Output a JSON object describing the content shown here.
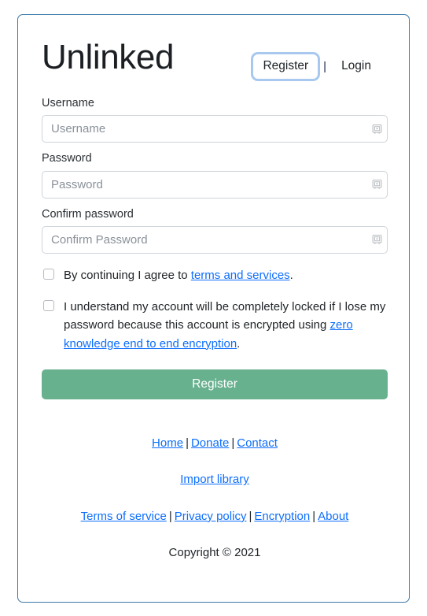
{
  "brand": {
    "title": "Unlinked"
  },
  "auth_nav": {
    "register_label": "Register",
    "separator": "|",
    "login_label": "Login",
    "focused_item": "Register",
    "focus_ring_color": "#a8c8f0"
  },
  "form": {
    "fields": [
      {
        "label": "Username",
        "placeholder": "Username",
        "value": "",
        "type": "text",
        "icon": "password-manager-icon"
      },
      {
        "label": "Password",
        "placeholder": "Password",
        "value": "",
        "type": "password",
        "icon": "password-manager-icon"
      },
      {
        "label": "Confirm password",
        "placeholder": "Confirm Password",
        "value": "",
        "type": "password",
        "icon": "password-manager-icon"
      }
    ],
    "checkboxes": [
      {
        "checked": false,
        "text_before": "By continuing I agree to ",
        "link_text": "terms and services",
        "text_after": "."
      },
      {
        "checked": false,
        "text_before": "I understand my account will be completely locked if I lose my password because this account is encrypted using ",
        "link_text": "zero knowledge end to end encryption",
        "text_after": "."
      }
    ],
    "submit_label": "Register",
    "submit_color": "#68b18f"
  },
  "footer": {
    "row1": [
      {
        "label": "Home"
      },
      {
        "label": "Donate"
      },
      {
        "label": "Contact"
      }
    ],
    "row2": [
      {
        "label": "Import library"
      }
    ],
    "row3": [
      {
        "label": "Terms of service"
      },
      {
        "label": "Privacy policy"
      },
      {
        "label": "Encryption"
      },
      {
        "label": "About"
      }
    ],
    "separator": "|",
    "copyright": "Copyright © 2021",
    "link_color": "#0d6efd"
  },
  "card": {
    "border_color": "#3c78a8"
  }
}
